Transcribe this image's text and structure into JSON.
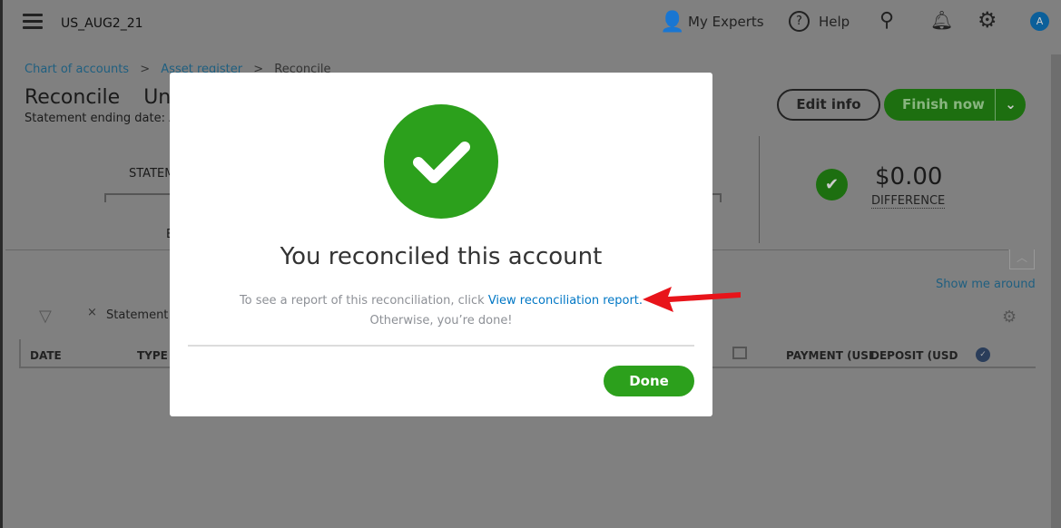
{
  "header": {
    "company": "US_AUG2_21",
    "my_experts": "My Experts",
    "help": "Help",
    "avatar": "A"
  },
  "breadcrumb": [
    "Chart of accounts",
    ">",
    "Asset register",
    ">",
    "Reconcile"
  ],
  "page": {
    "title": "Reconcile",
    "title_partial": "Un",
    "subtitle": "Statement ending date: A",
    "statement_label": "STATEM",
    "e_label": "E"
  },
  "actions": {
    "edit": "Edit info",
    "finish": "Finish now"
  },
  "difference": {
    "amount": "$0.00",
    "label": "DIFFERENCE"
  },
  "show_me_around": "Show me around",
  "filter": {
    "chip": "Statement e"
  },
  "table": {
    "columns": [
      "DATE",
      "TYPE",
      "PAYMENT (USI",
      "DEPOSIT (USD"
    ]
  },
  "modal": {
    "title": "You reconciled this account",
    "text_before": "To see a report of this reconciliation, click ",
    "link": "View reconciliation report.",
    "text_after": "Otherwise, you’re done!",
    "done": "Done"
  },
  "colors": {
    "green": "#2ca01c",
    "link": "#0077c5",
    "arrow": "#e8141a"
  }
}
